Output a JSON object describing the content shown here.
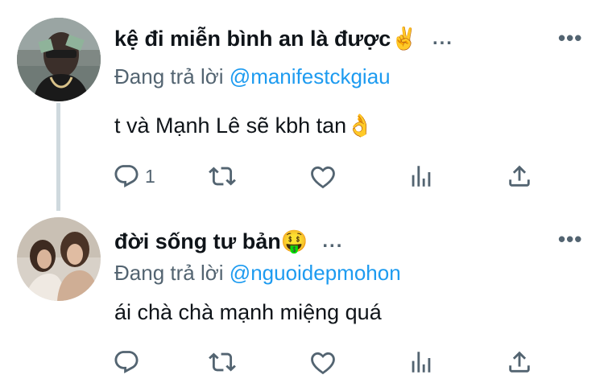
{
  "tweets": [
    {
      "display_name": "kệ đi miễn bình an là được",
      "name_emoji": "✌️",
      "name_menu": "...",
      "reply_prefix": "Đang trả lời",
      "reply_to": "@manifestckgiau",
      "text": "t và Mạnh Lê sẽ kbh tan",
      "text_emoji": "👌",
      "reply_count": "1",
      "more": "•••"
    },
    {
      "display_name": "đời sống tư bản",
      "name_emoji": "🤑",
      "name_menu": "...",
      "reply_prefix": "Đang trả lời",
      "reply_to": "@nguoidepmohon",
      "text": "ái chà chà mạnh miệng quá",
      "text_emoji": "",
      "reply_count": "",
      "more": "•••"
    }
  ],
  "colors": {
    "text": "#0f1419",
    "muted": "#536471",
    "accent": "#1d9bf0",
    "thread": "#cfd9de"
  },
  "icons": [
    "reply-icon",
    "retweet-icon",
    "like-icon",
    "stats-icon",
    "share-icon",
    "more-icon"
  ]
}
